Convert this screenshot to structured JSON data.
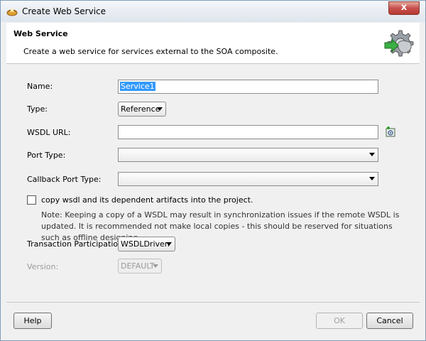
{
  "window": {
    "title": "Create Web Service",
    "close_label": "x"
  },
  "header": {
    "title": "Web Service",
    "description": "Create a web service for services external to the SOA composite."
  },
  "form": {
    "name": {
      "label": "Name:",
      "value": "Service1"
    },
    "type": {
      "label": "Type:",
      "value": "Reference"
    },
    "wsdl_url": {
      "label": "WSDL URL:",
      "value": ""
    },
    "port_type": {
      "label": "Port Type:",
      "value": ""
    },
    "callback_port_type": {
      "label": "Callback Port Type:",
      "value": ""
    },
    "copy_wsdl": {
      "label": "copy wsdl and its dependent artifacts into the project.",
      "checked": false
    },
    "note": "Note: Keeping a copy of a WSDL may result in synchronization issues if the remote WSDL is updated. It is recommended not make local copies - this should be reserved for situations such as offline designing.",
    "transaction": {
      "label": "Transaction Participation:",
      "value": "WSDLDriven"
    },
    "version": {
      "label": "Version:",
      "value": "DEFAULT"
    }
  },
  "footer": {
    "help": "Help",
    "ok": "OK",
    "cancel": "Cancel"
  },
  "icons": {
    "app": "jdeveloper-icon",
    "header": "web-service-gear-icon",
    "browse": "browse-wsdl-icon"
  },
  "colors": {
    "selection": "#3399ff",
    "close_button": "#c75050"
  }
}
